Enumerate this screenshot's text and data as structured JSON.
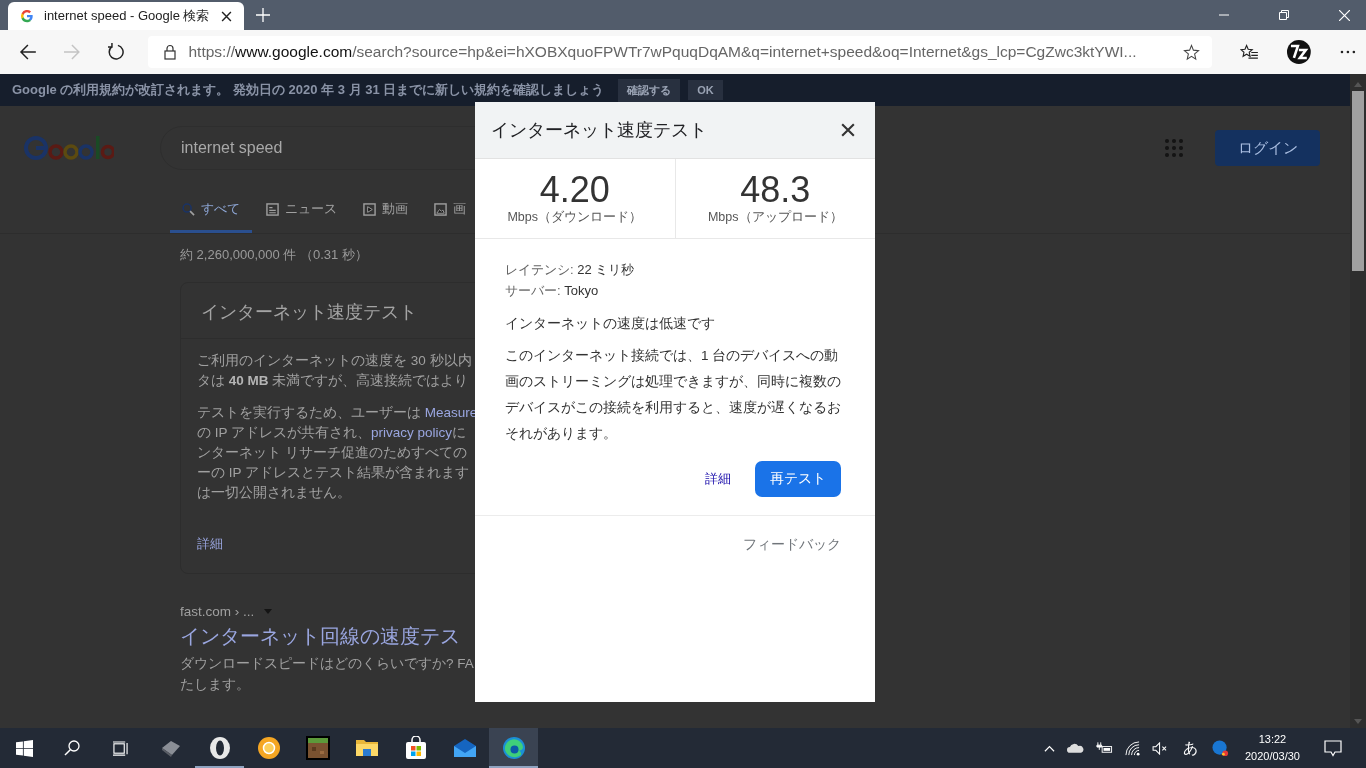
{
  "browser": {
    "tab": {
      "title": "internet speed - Google 検索"
    },
    "forward": {
      "disabled": true
    },
    "url": {
      "scheme": "https://",
      "host": "www.google.com",
      "rest": "/search?source=hp&ei=hXOBXquoFPWTr7wPquqDqAM&q=internet+speed&oq=Internet&gs_lcp=CgZwc3ktYWI..."
    }
  },
  "notice": {
    "text": "Google の利用規約が改訂されます。 発効日の 2020 年 3 月 31 日までに新しい規約を確認しましょう",
    "buttons": [
      "確認する",
      "OK"
    ]
  },
  "search": {
    "query": "internet speed",
    "login": "ログイン"
  },
  "tabs": [
    {
      "label": "すべて",
      "kind": "all",
      "selected": true
    },
    {
      "label": "ニュース",
      "kind": "news",
      "selected": false
    },
    {
      "label": "動画",
      "kind": "video",
      "selected": false
    },
    {
      "label": "画",
      "kind": "images",
      "selected": false
    }
  ],
  "result_stats": "約 2,260,000,000 件 （0.31 秒）",
  "speed_card": {
    "title": "インターネット速度テスト",
    "paragraphs": [
      [
        [
          {
            "text": "ご利用のインターネットの速度を 30 秒以内",
            "kind": "plain"
          }
        ],
        [
          {
            "text": "タは ",
            "kind": "plain"
          },
          {
            "text": "40 MB",
            "kind": "bold"
          },
          {
            "text": " 未満ですが、高速接続ではより",
            "kind": "plain"
          }
        ]
      ],
      [
        [
          {
            "text": "テストを実行するため、ユーザーは ",
            "kind": "plain"
          },
          {
            "text": "Measure",
            "kind": "link"
          }
        ],
        [
          {
            "text": "の IP アドレスが共有され、",
            "kind": "plain"
          },
          {
            "text": "privacy policy",
            "kind": "link"
          },
          {
            "text": "に",
            "kind": "plain"
          }
        ],
        [
          {
            "text": "ンターネット リサーチ促進のためすべての",
            "kind": "plain"
          }
        ],
        [
          {
            "text": "ーの IP アドレスとテスト結果が含まれます",
            "kind": "plain"
          }
        ],
        [
          {
            "text": "は一切公開されません。",
            "kind": "plain"
          }
        ]
      ]
    ],
    "more": "詳細"
  },
  "results": [
    {
      "breadcrumb": "fast.com › ...",
      "title": "インターネット回線の速度テス",
      "snippet_lines": [
        "ダウンロードスピードはどのくらいですか? FA",
        "たします。"
      ]
    }
  ],
  "dialog": {
    "title": "インターネット速度テスト",
    "metrics": [
      {
        "value": "4.20",
        "unit": "Mbps（ダウンロード）"
      },
      {
        "value": "48.3",
        "unit": "Mbps（アップロード）"
      }
    ],
    "details": [
      {
        "label": "レイテンシ:",
        "value": "22 ミリ秒"
      },
      {
        "label": "サーバー:",
        "value": "Tokyo"
      }
    ],
    "verdict": "インターネットの速度は低速です",
    "description": "このインターネット接続では、1 台のデバイスへの動画のストリーミングは処理できますが、同時に複数のデバイスがこの接続を利用すると、速度が遅くなるおそれがあります。",
    "more": "詳細",
    "retest": "再テスト",
    "feedback": "フィードバック"
  },
  "taskbar": {
    "apps": [
      {
        "kind": "gem",
        "running": false,
        "selected": false
      },
      {
        "kind": "opera",
        "running": true,
        "selected": false
      },
      {
        "kind": "canary",
        "running": false,
        "selected": false
      },
      {
        "kind": "minecraft",
        "running": false,
        "selected": false
      },
      {
        "kind": "explorer",
        "running": false,
        "selected": false
      },
      {
        "kind": "store",
        "running": false,
        "selected": false
      },
      {
        "kind": "mail",
        "running": false,
        "selected": false
      },
      {
        "kind": "edge",
        "running": true,
        "selected": true
      }
    ],
    "ime": "あ",
    "clock": {
      "time": "13:22",
      "date": "2020/03/30"
    }
  }
}
